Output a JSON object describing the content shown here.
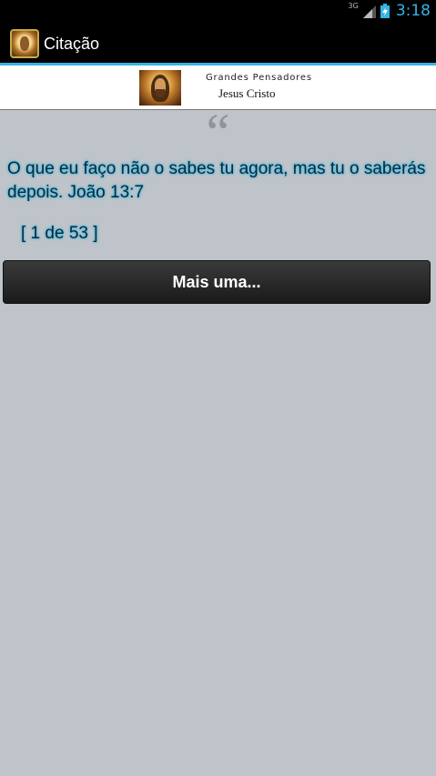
{
  "status_bar": {
    "network_type": "3G",
    "time": "3:18",
    "icons": [
      "signal-icon",
      "battery-charging-icon"
    ],
    "time_color": "#33b5e5"
  },
  "action_bar": {
    "title": "Citação",
    "icon": "app-icon"
  },
  "banner": {
    "subtitle": "Grandes Pensadores",
    "title": "Jesus Cristo"
  },
  "quote": {
    "mark": "“",
    "text": "O que eu faço não o sabes tu agora, mas tu o saberás\ndepois. João 13:7",
    "counter": "[ 1 de 53 ]"
  },
  "button": {
    "label": "Mais uma..."
  },
  "colors": {
    "background": "#bec4c9",
    "accent": "#33b5e5"
  }
}
